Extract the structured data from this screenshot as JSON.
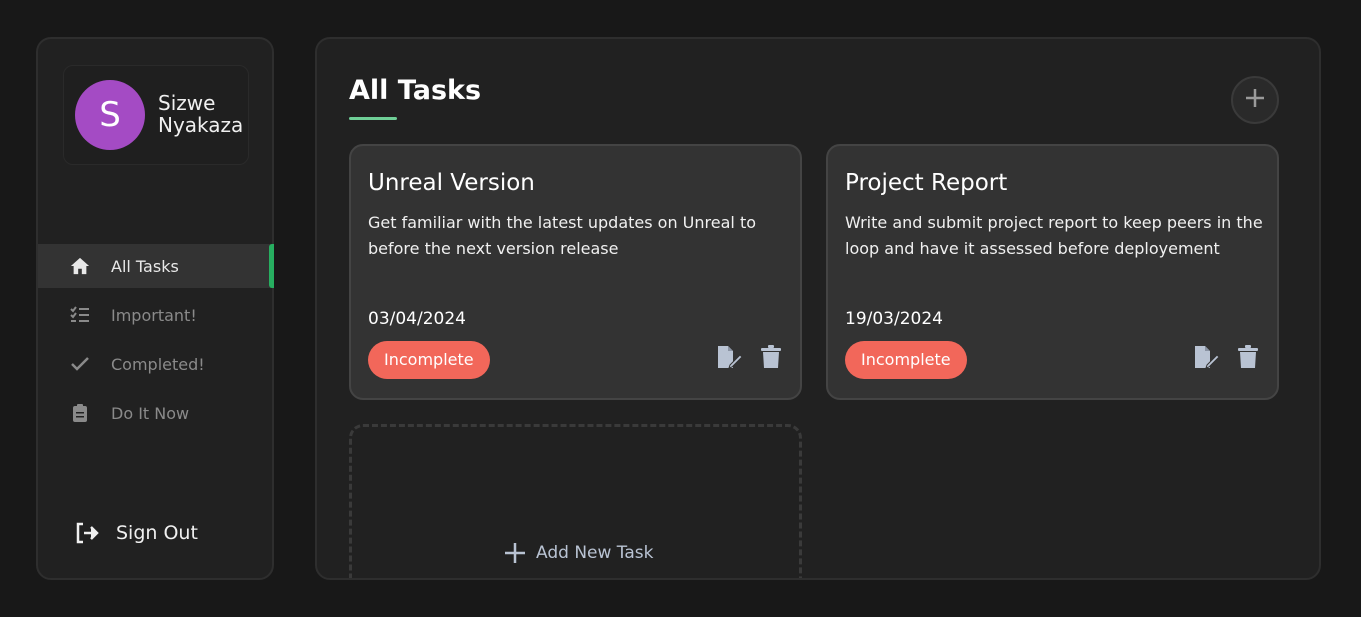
{
  "user": {
    "initial": "S",
    "name": "Sizwe Nyakaza",
    "avatar_color": "#a44bc4"
  },
  "nav": {
    "items": [
      {
        "label": "All Tasks",
        "icon": "home-icon",
        "active": true
      },
      {
        "label": "Important!",
        "icon": "checklist-icon",
        "active": false
      },
      {
        "label": "Completed!",
        "icon": "check-icon",
        "active": false
      },
      {
        "label": "Do It Now",
        "icon": "clipboard-icon",
        "active": false
      }
    ],
    "signout_label": "Sign Out"
  },
  "main": {
    "title": "All Tasks",
    "add_task_label": "Add New Task"
  },
  "tasks": [
    {
      "title": "Unreal Version",
      "description": "Get familiar with the latest updates on Unreal to before the next version release",
      "date": "03/04/2024",
      "status": "Incomplete"
    },
    {
      "title": "Project Report",
      "description": "Write and submit project report to keep peers in the loop and have it assessed before deployement",
      "date": "19/03/2024",
      "status": "Incomplete"
    }
  ],
  "colors": {
    "accent": "#27ae60",
    "underline": "#6fcf97",
    "incomplete": "#f2675a"
  }
}
